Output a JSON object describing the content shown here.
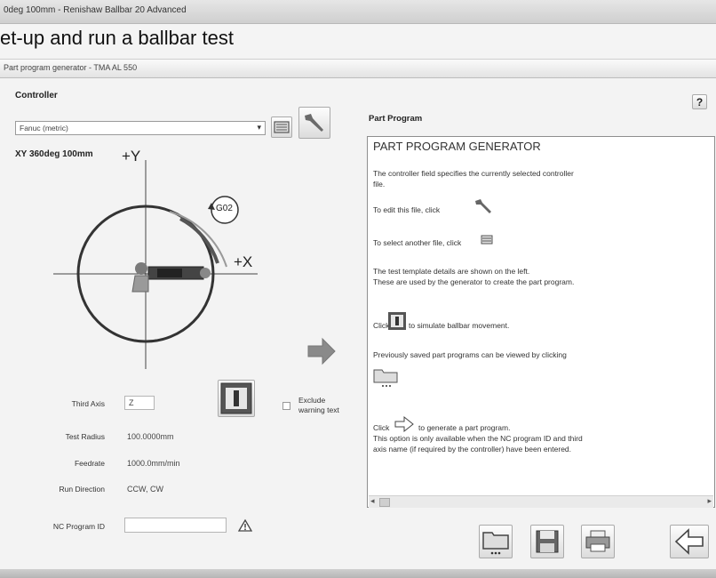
{
  "window_title": "0deg 100mm - Renishaw Ballbar 20 Advanced",
  "page_heading": "et-up and run a ballbar test",
  "subbar_title": "Part program generator - TMA AL 550",
  "controller": {
    "label": "Controller",
    "selected": "Fanuc (metric)"
  },
  "help_label": "?",
  "test": {
    "name": "XY 360deg 100mm",
    "plus_y": "+Y",
    "plus_x": "+X",
    "g_code": "G02"
  },
  "fields": {
    "third_axis_label": "Third Axis",
    "third_axis_value": "Z",
    "test_radius_label": "Test Radius",
    "test_radius_value": "100.0000mm",
    "feedrate_label": "Feedrate",
    "feedrate_value": "1000.0mm/min",
    "run_direction_label": "Run Direction",
    "run_direction_value": "CCW, CW",
    "nc_program_id_label": "NC Program ID",
    "nc_program_id_value": ""
  },
  "exclude_warning": {
    "label_line1": "Exclude",
    "label_line2": "warning text",
    "checked": false
  },
  "part_program": {
    "label": "Part Program",
    "title": "PART PROGRAM GENERATOR",
    "lines": {
      "l1": "The controller field specifies the currently selected controller",
      "l2": "file.",
      "l3": "To edit this file, click",
      "l4": "To select another file, click",
      "l5": "The test template details are shown on the left.",
      "l6": "These are used by the generator to create the part program.",
      "l7a": "Click",
      "l7b": "to simulate ballbar movement.",
      "l8": "Previously saved part programs can be viewed by clicking",
      "l9a": "Click",
      "l9b": "to generate a part program.",
      "l10": "This option is only available when the NC program ID and third",
      "l11": "axis name (if required by the controller) have been entered."
    }
  },
  "colors": {
    "background": "#f3f3f3",
    "panel_border": "#8e8e8e",
    "arrow_fill": "#8a8a8a"
  },
  "icons": {
    "open_file": "folder-open-icon",
    "save": "floppy-disk-icon",
    "print": "printer-icon",
    "back": "back-arrow-icon",
    "edit": "wrench-icon",
    "select_file": "file-browse-icon",
    "simulate": "simulate-icon",
    "generate": "right-arrow-icon",
    "warning": "warning-triangle-icon",
    "help": "help-icon"
  }
}
